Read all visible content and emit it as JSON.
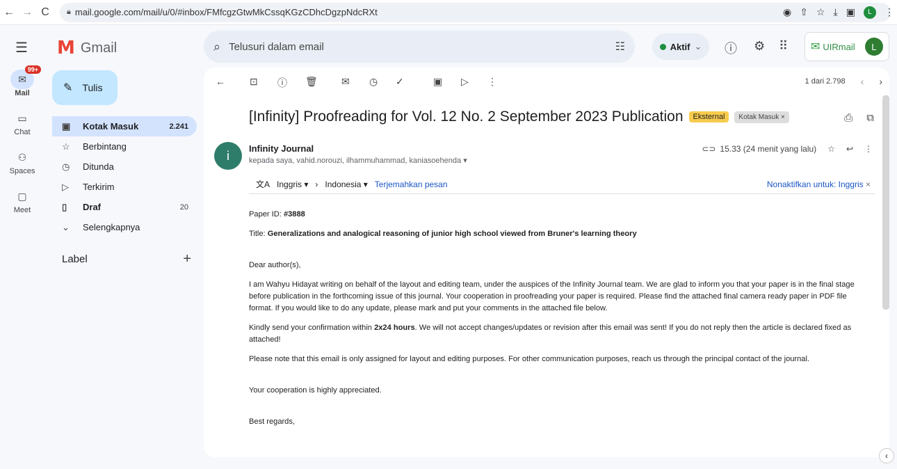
{
  "browser": {
    "back": "←",
    "forward": "→",
    "reload": "C",
    "url": "mail.google.com/mail/u/0/#inbox/FMfcgzGtwMkCssqKGzCDhcDgzpNdcRXt",
    "profile_initial": "L"
  },
  "gmail": {
    "app_name": "Gmail",
    "search_placeholder": "Telusuri dalam email",
    "status_label": "Aktif",
    "addon_label": "UIRmail",
    "account_initial": "L"
  },
  "rail": [
    {
      "label": "Mail",
      "icon": "mail-icon",
      "badge": "99+",
      "active": true
    },
    {
      "label": "Chat",
      "icon": "chat-icon"
    },
    {
      "label": "Spaces",
      "icon": "spaces-icon"
    },
    {
      "label": "Meet",
      "icon": "meet-icon"
    }
  ],
  "sidebar": {
    "compose_label": "Tulis",
    "items": [
      {
        "label": "Kotak Masuk",
        "count": "2.241",
        "icon": "inbox-icon"
      },
      {
        "label": "Berbintang",
        "count": "",
        "icon": "star-icon"
      },
      {
        "label": "Ditunda",
        "count": "",
        "icon": "clock-icon"
      },
      {
        "label": "Terkirim",
        "count": "",
        "icon": "send-icon"
      },
      {
        "label": "Draf",
        "count": "20",
        "icon": "draft-icon"
      },
      {
        "label": "Selengkapnya",
        "count": "",
        "icon": "chevron-down-icon"
      }
    ],
    "label_header": "Label"
  },
  "toolbar": {
    "pager_text": "1 dari 2.798"
  },
  "email": {
    "subject": "[Infinity] Proofreading for Vol. 12 No. 2 September 2023 Publication",
    "chip_external": "Eksternal",
    "chip_inbox": "Kotak Masuk ×",
    "sender_initial": "i",
    "sender_name": "Infinity Journal",
    "recipients": "kepada saya, vahid.norouzi, ilhammuhammad, kaniasoehenda ▾",
    "time": "15.33 (24 menit yang lalu)",
    "translate": {
      "from_lang": "Inggris ▾",
      "to_lang": "Indonesia ▾",
      "translate_link": "Terjemahkan pesan",
      "disable_link": "Nonaktifkan untuk: Inggris"
    },
    "paper_id_label": "Paper ID: ",
    "paper_id": "#3888",
    "title_label": "Title: ",
    "title": "Generalizations and analogical reasoning of junior high school viewed from Bruner's learning theory",
    "greeting": "Dear author(s),",
    "para1": "I am Wahyu Hidayat writing on behalf of the layout and editing team, under the auspices of the Infinity Journal team. We are glad to inform you that your paper is in the final stage before publication in the forthcoming issue of this journal. Your cooperation in proofreading your paper is required. Please find the attached final camera ready paper in PDF file format. If you would like to do any update, please mark and put your comments in the attached file below.",
    "para2_a": "Kindly send your confirmation within ",
    "para2_b": "2x24 hours",
    "para2_c": ". We will not accept changes/updates or revision after this email was sent! If you do not reply then the article is declared fixed as attached!",
    "para3": "Please note that this email is only assigned for layout and editing purposes. For other communication purposes, reach us through the principal contact of the journal.",
    "para4": "Your cooperation is highly appreciated.",
    "closing": "Best regards,"
  }
}
